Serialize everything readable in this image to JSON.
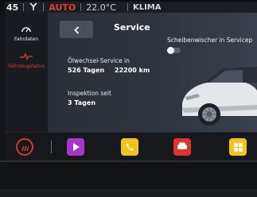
{
  "statusbar": {
    "time_partial": "45",
    "auto_label": "AUTO",
    "temperature": "22.0°C",
    "climate_label": "KLIMA"
  },
  "sidebar": {
    "items": [
      {
        "label": "Fahrdaten",
        "icon": "speedometer-icon"
      },
      {
        "label": "Fahrzeugstatus",
        "icon": "heartbeat-icon"
      }
    ]
  },
  "service": {
    "back_icon": "chevron-left-icon",
    "title": "Service",
    "wiper_label": "Scheibenwischer in Servicep",
    "wiper_toggle_on": false,
    "oil_label": "Ölwechsel-Service in",
    "oil_days": "526 Tagen",
    "oil_km": "22200 km",
    "inspection_label": "Inspektion seit",
    "inspection_days": "3 Tagen"
  },
  "appbar": {
    "home_color": "#d23a2f",
    "apps": [
      {
        "name": "media",
        "color": "#a837c9",
        "icon": "play-icon"
      },
      {
        "name": "phone",
        "color": "#f0c419",
        "icon": "phone-icon"
      },
      {
        "name": "car",
        "color": "#e0332b",
        "icon": "car-settings-icon"
      },
      {
        "name": "apps",
        "color": "#f4c416",
        "icon": "apps-icon"
      }
    ]
  }
}
